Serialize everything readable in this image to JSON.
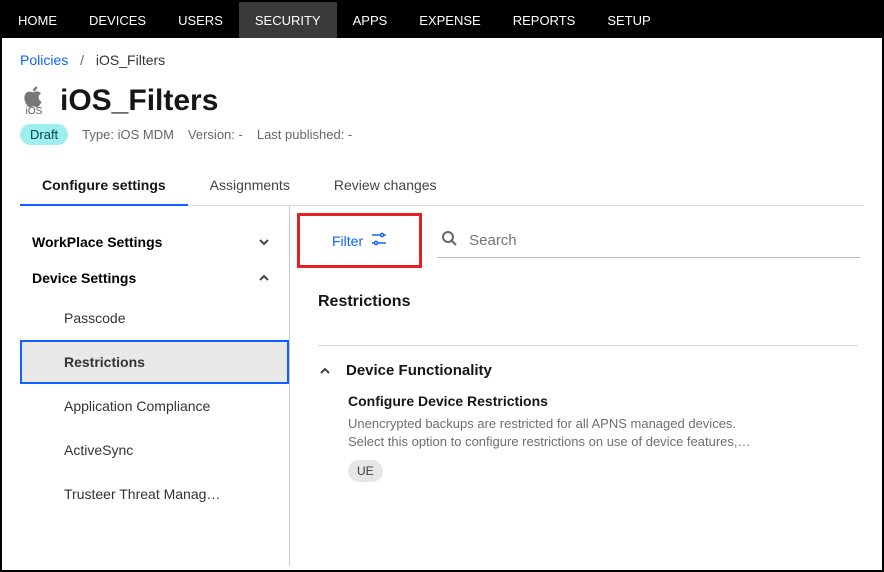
{
  "nav": {
    "items": [
      "HOME",
      "DEVICES",
      "USERS",
      "SECURITY",
      "APPS",
      "EXPENSE",
      "REPORTS",
      "SETUP"
    ],
    "activeIndex": 3
  },
  "breadcrumb": {
    "parent": "Policies",
    "current": "iOS_Filters"
  },
  "header": {
    "osLabel": "iOS",
    "title": "iOS_Filters",
    "badge": "Draft",
    "type": "Type: iOS MDM",
    "version": "Version: -",
    "lastPub": "Last published: -"
  },
  "tabs": [
    "Configure settings",
    "Assignments",
    "Review changes"
  ],
  "sidebar": {
    "group1": "WorkPlace Settings",
    "group2": "Device Settings",
    "items": [
      "Passcode",
      "Restrictions",
      "Application Compliance",
      "ActiveSync",
      "Trusteer Threat Manag…"
    ]
  },
  "filter": {
    "label": "Filter"
  },
  "search": {
    "placeholder": "Search"
  },
  "section": {
    "title": "Restrictions"
  },
  "accordion": {
    "title": "Device Functionality",
    "subtitle": "Configure Device Restrictions",
    "desc1": "Unencrypted backups are restricted for all APNS managed devices.",
    "desc2": "Select this option to configure restrictions on use of device features,…",
    "chip": "UE"
  }
}
